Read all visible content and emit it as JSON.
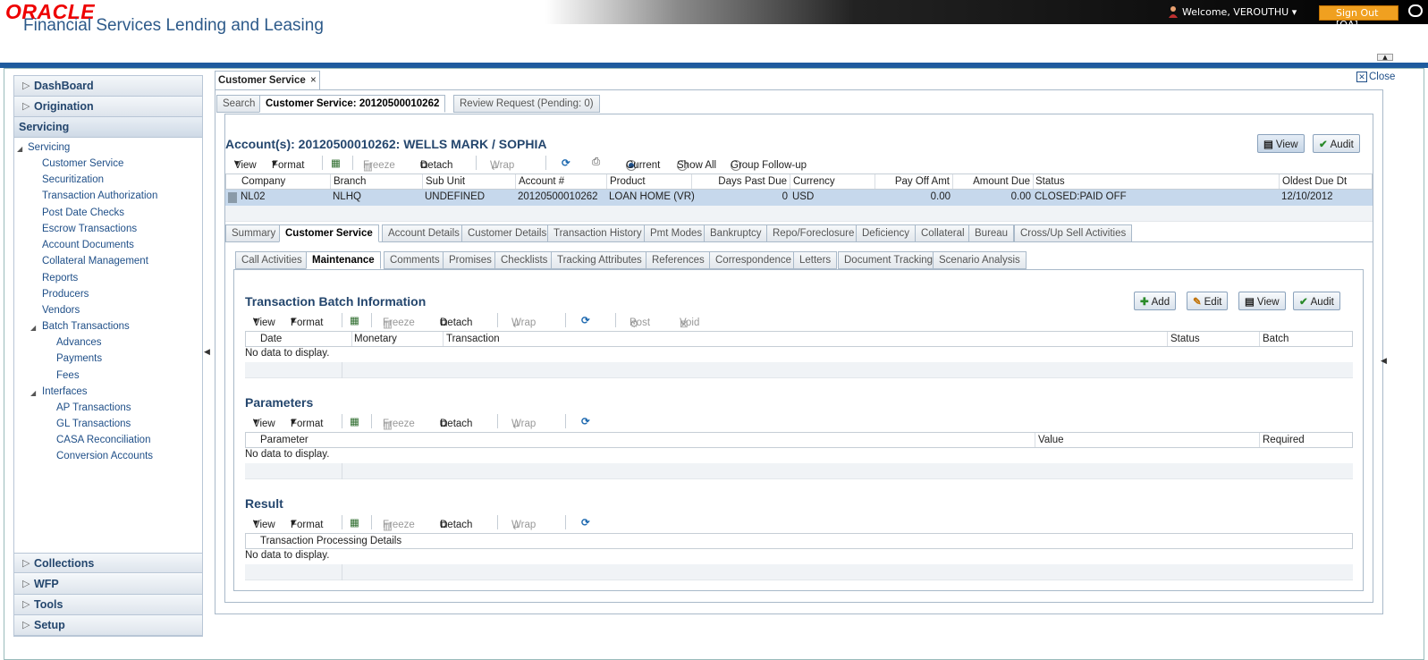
{
  "header": {
    "logo_top": "ORACLE",
    "logo_bottom": "Financial Services Lending and Leasing",
    "welcome": "Welcome, VEROUTHU",
    "signout": "Sign Out [QA]"
  },
  "sidebar": {
    "sections": [
      "DashBoard",
      "Origination",
      "Servicing",
      "Collections",
      "WFP",
      "Tools",
      "Setup"
    ],
    "servicing_root": "Servicing",
    "items": [
      "Customer Service",
      "Securitization",
      "Transaction Authorization",
      "Post Date Checks",
      "Escrow Transactions",
      "Account Documents",
      "Collateral Management",
      "Reports",
      "Producers",
      "Vendors"
    ],
    "batch": "Batch Transactions",
    "batch_items": [
      "Advances",
      "Payments",
      "Fees"
    ],
    "interfaces": "Interfaces",
    "interface_items": [
      "AP Transactions",
      "GL Transactions",
      "CASA Reconciliation",
      "Conversion Accounts"
    ]
  },
  "main": {
    "tab": "Customer Service",
    "close": "Close",
    "subtabs": [
      "Search",
      "Customer Service: 20120500010262",
      "Review Request (Pending: 0)"
    ],
    "account_title": "Account(s): 20120500010262: WELLS MARK / SOPHIA",
    "view_btn": "View",
    "audit_btn": "Audit",
    "toolbar": {
      "view": "View",
      "format": "Format",
      "freeze": "Freeze",
      "detach": "Detach",
      "wrap": "Wrap",
      "post": "Post",
      "void": "Void"
    },
    "radios": [
      "Current",
      "Show All",
      "Group Follow-up"
    ],
    "account_columns": [
      "Company",
      "Branch",
      "Sub Unit",
      "Account #",
      "Product",
      "Days Past Due",
      "Currency",
      "Pay Off Amt",
      "Amount Due",
      "Status",
      "Oldest Due Dt"
    ],
    "account_row": [
      "NL02",
      "NLHQ",
      "UNDEFINED",
      "20120500010262",
      "LOAN HOME (VR)",
      "0",
      "USD",
      "0.00",
      "0.00",
      "CLOSED:PAID OFF",
      "12/10/2012"
    ],
    "tabs": [
      "Summary",
      "Customer Service",
      "Account Details",
      "Customer Details",
      "Transaction History",
      "Pmt Modes",
      "Bankruptcy",
      "Repo/Foreclosure",
      "Deficiency",
      "Collateral",
      "Bureau",
      "Cross/Up Sell Activities"
    ],
    "cs_tabs": [
      "Call Activities",
      "Maintenance",
      "Comments",
      "Promises",
      "Checklists",
      "Tracking Attributes",
      "References",
      "Correspondence",
      "Letters",
      "Document Tracking",
      "Scenario Analysis"
    ],
    "tbi": {
      "title": "Transaction Batch Information",
      "add": "Add",
      "edit": "Edit",
      "view": "View",
      "audit": "Audit",
      "columns": [
        "Date",
        "Monetary",
        "Transaction",
        "Status",
        "Batch"
      ],
      "nodata": "No data to display."
    },
    "params": {
      "title": "Parameters",
      "columns": [
        "Parameter",
        "Value",
        "Required"
      ],
      "nodata": "No data to display."
    },
    "result": {
      "title": "Result",
      "columns": [
        "Transaction Processing Details"
      ],
      "nodata": "No data to display."
    }
  },
  "colors": {
    "brand_red": "#e00000",
    "nav_blue": "#1f5b9e",
    "title_blue": "#24466d",
    "selected_row": "#c6d8ec",
    "signout_orange": "#f0a020"
  }
}
